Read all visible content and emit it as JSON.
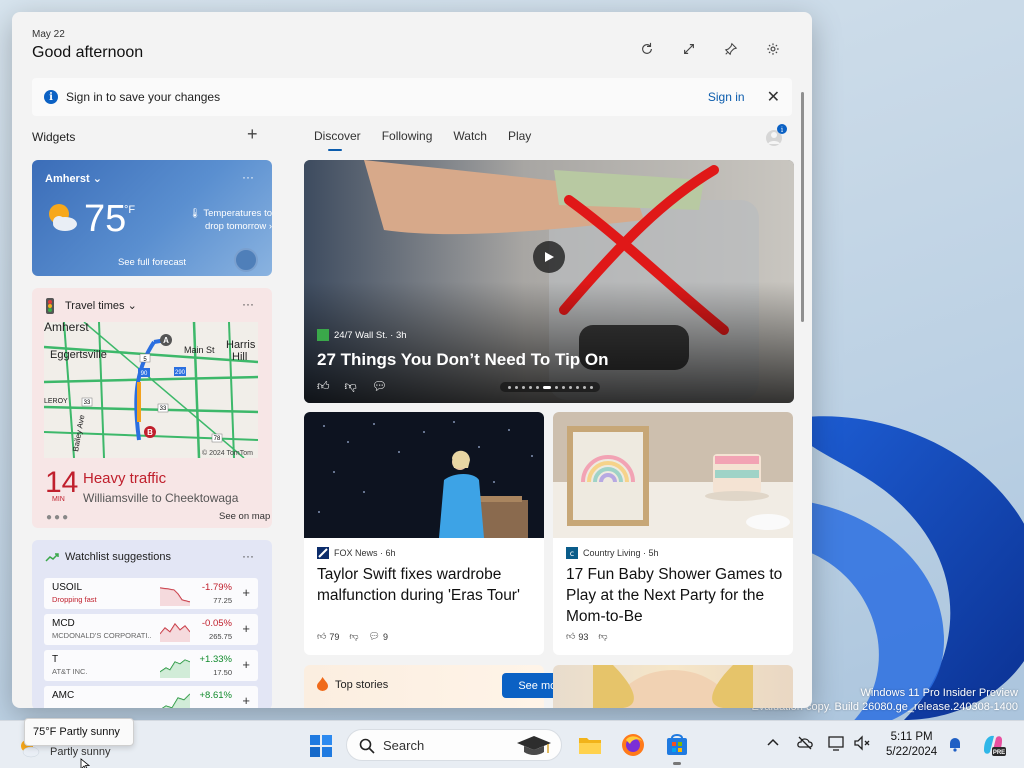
{
  "panel": {
    "date": "May 22",
    "greeting": "Good afternoon",
    "header_icons": [
      "refresh-icon",
      "expand-icon",
      "pin-icon",
      "settings-icon"
    ]
  },
  "signin_bar": {
    "message": "Sign in to save your changes",
    "link": "Sign in"
  },
  "widgets": {
    "label": "Widgets",
    "weather": {
      "location": "Amherst",
      "temperature": "75",
      "unit": "°F",
      "note_line1": "Temperatures to",
      "note_line2": "drop tomorrow",
      "forecast_link": "See full forecast"
    },
    "travel": {
      "title": "Travel times",
      "minutes": "14",
      "minutes_label": "MIN",
      "status": "Heavy traffic",
      "route": "Williamsville to Cheektowaga",
      "map_link": "See on map",
      "map_labels": [
        "Amherst",
        "Eggertsville",
        "Main St",
        "Harris",
        "Hill",
        "LEROY",
        "Bailey Ave",
        "© 2024 TomTom"
      ],
      "marker_a": "A",
      "marker_b": "B",
      "road_numbers": [
        "5",
        "90",
        "290",
        "33",
        "33",
        "78"
      ],
      "accent_color": "#c0202d"
    },
    "watchlist": {
      "title": "Watchlist suggestions",
      "stocks": [
        {
          "symbol": "USOIL",
          "name": "Dropping fast",
          "name_red": true,
          "change": "-1.79%",
          "price": "77.25",
          "direction": "neg"
        },
        {
          "symbol": "MCD",
          "name": "MCDONALD'S CORPORATI...",
          "name_red": false,
          "change": "-0.05%",
          "price": "265.75",
          "direction": "neg"
        },
        {
          "symbol": "T",
          "name": "AT&T INC.",
          "name_red": false,
          "change": "+1.33%",
          "price": "17.50",
          "direction": "pos"
        },
        {
          "symbol": "AMC",
          "name": "",
          "name_red": false,
          "change": "+8.61%",
          "price": "",
          "direction": "pos"
        }
      ]
    }
  },
  "feed": {
    "tabs": [
      "Discover",
      "Following",
      "Watch",
      "Play"
    ],
    "active_tab": "Discover",
    "hero": {
      "source": "24/7 Wall St. · 3h",
      "title": "27 Things You Don’t Need To Tip On"
    },
    "articles": [
      {
        "source": "FOX News · 6h",
        "title": "Taylor Swift fixes wardrobe malfunction during 'Eras Tour'",
        "likes": "79",
        "comments": "9"
      },
      {
        "source": "Country Living · 5h",
        "title": "17 Fun Baby Shower Games to Play at the Next Party for the Mom-to-Be",
        "likes": "93"
      }
    ],
    "top_stories": {
      "label": "Top stories",
      "button": "See more"
    }
  },
  "desktop": {
    "watermark_line1": "Windows 11 Pro Insider Preview",
    "watermark_line2": "Evaluation copy. Build 26080.ge_release.240308-1400"
  },
  "taskbar": {
    "weather_tooltip": "75°F Partly sunny",
    "weather_text": "Partly sunny",
    "search_placeholder": "Search",
    "time": "5:11 PM",
    "date": "5/22/2024",
    "apps": [
      "file-explorer-icon",
      "firefox-icon",
      "store-icon"
    ],
    "tray_icons": [
      "chevron-up-icon",
      "network-off-icon",
      "display-icon",
      "volume-icon",
      "notification-bell-icon",
      "copilot-icon"
    ]
  }
}
